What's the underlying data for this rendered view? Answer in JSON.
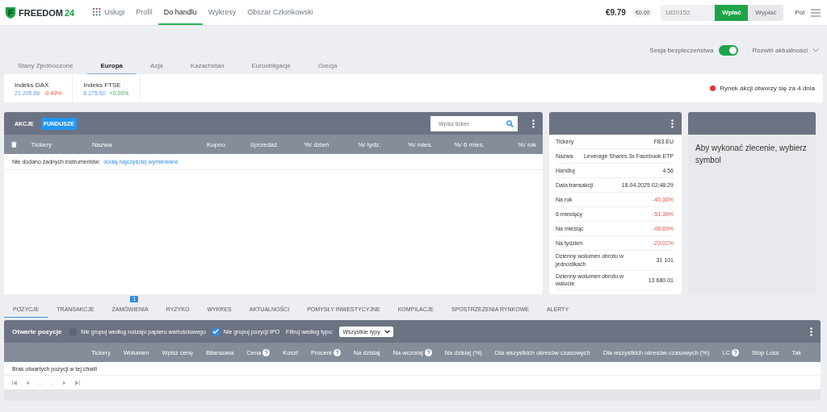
{
  "header": {
    "brand": "FREEDOM",
    "brand_number": "24",
    "nav": [
      {
        "label": "Usługi",
        "kind": "apps",
        "selected": false
      },
      {
        "label": "Profil",
        "kind": "plain",
        "selected": false
      },
      {
        "label": "Do handlu",
        "kind": "plain",
        "selected": true
      },
      {
        "label": "Wykresy",
        "kind": "plain",
        "selected": false
      },
      {
        "label": "Obszar Członkowski",
        "kind": "plain",
        "selected": false
      }
    ],
    "balance": "€9.79",
    "balance_pill": "€0.00",
    "account": "1820152",
    "deposit_button": "Wpłać",
    "withdraw_button": "Wypłać",
    "language": "Pol"
  },
  "security": {
    "label": "Sesja bezpieczeństwa",
    "on": true,
    "news_toggle": "Rozwiń aktualności"
  },
  "regions": [
    {
      "label": "Stany Zjednoczone",
      "selected": false
    },
    {
      "label": "Europa",
      "selected": true
    },
    {
      "label": "Azja",
      "selected": false
    },
    {
      "label": "Kazachstan",
      "selected": false
    },
    {
      "label": "Euroobligacje",
      "selected": false
    },
    {
      "label": "Grecja",
      "selected": false
    }
  ],
  "indices": [
    {
      "name": "Indeks DAX",
      "value": "21 205.86",
      "change": "-0.49%",
      "negative": true
    },
    {
      "name": "Indeks FTSE",
      "value": "8 275.50",
      "change": "+0.00%",
      "negative": false
    }
  ],
  "market_status": {
    "text": "Rynek akcji otworzy się za 4 dnia",
    "color": "#e53935"
  },
  "watchlist": {
    "tabs": [
      {
        "label": "AKCJE",
        "selected": false
      },
      {
        "label": "FUNDUSZE",
        "selected": true
      }
    ],
    "search": {
      "placeholder": "Wpisz ticker"
    },
    "columns": [
      "Tickery",
      "Nazwa",
      "Kupno",
      "Sprzedaż",
      "%/ dzień",
      "%/ tydz.",
      "%/ mies.",
      "%/ 6 mies.",
      "%/ rok"
    ],
    "empty_text": "Nie dodano żadnych instrumentów:",
    "empty_link": "dodaj najczęściej wymieniane"
  },
  "info": {
    "rows": [
      {
        "label": "Tickery",
        "value": "FB3.EU",
        "negative": false
      },
      {
        "label": "Nazwa",
        "value": "Leverage Shares 3x Facebook ETP",
        "negative": false
      },
      {
        "label": "Handluj",
        "value": "4.56",
        "negative": false
      },
      {
        "label": "Data transakcji",
        "value": "18.04.2025 02:48:29",
        "negative": false
      },
      {
        "label": "Na rok",
        "value": "-40.36%",
        "negative": true
      },
      {
        "label": "6 miesięcy",
        "value": "-51.36%",
        "negative": true
      },
      {
        "label": "Na miesiąc",
        "value": "-48.69%",
        "negative": true
      },
      {
        "label": "Na tydzień",
        "value": "-23.01%",
        "negative": true
      },
      {
        "label": "Dzienny wolumen obrotu w jednostkach",
        "value": "31 101",
        "negative": false
      },
      {
        "label": "Dzienny wolumen obrotu w walucie",
        "value": "13 680.01",
        "negative": false
      }
    ]
  },
  "order": {
    "message": "Aby wykonać zlecenie, wybierz symbol"
  },
  "bottom_tabs": [
    {
      "label": "POZYCJE",
      "selected": true
    },
    {
      "label": "TRANSAKCJE",
      "selected": false
    },
    {
      "label": "ZAMÓWIENIA",
      "selected": false,
      "badge": "1"
    },
    {
      "label": "RYZYKO",
      "selected": false
    },
    {
      "label": "WYKRES",
      "selected": false
    },
    {
      "label": "AKTUALNOŚCI",
      "selected": false
    },
    {
      "label": "POMYSŁY INWESTYCYJNE",
      "selected": false
    },
    {
      "label": "KOMPILACJE",
      "selected": false
    },
    {
      "label": "SPOSTRZEŻENIA RYNKOWE",
      "selected": false
    },
    {
      "label": "ALERTY",
      "selected": false
    }
  ],
  "positions": {
    "title": "Otwarte pozycje",
    "options": [
      {
        "label": "Nie grupuj według rodzaju papieru wartościowego",
        "checked": false
      },
      {
        "label": "Nie grupuj pozycji IPO",
        "checked": true
      }
    ],
    "filter_label": "Filtruj według typu:",
    "filter_value": "Wszystkie typy",
    "columns": [
      {
        "label": "Tickery",
        "help": false
      },
      {
        "label": "Wolumen",
        "help": false
      },
      {
        "label": "Wpisz cenę",
        "help": false
      },
      {
        "label": "Bilansowa",
        "help": false
      },
      {
        "label": "Cena",
        "help": true
      },
      {
        "label": "Koszt",
        "help": false
      },
      {
        "label": "Procent",
        "help": true
      },
      {
        "label": "Na dzisiaj",
        "help": false
      },
      {
        "label": "Na wczoraj",
        "help": true
      },
      {
        "label": "Na dzisiaj (%)",
        "help": false
      },
      {
        "label": "Dla wszystkich okresów czasowych",
        "help": false
      },
      {
        "label": "Dla wszystkich okresów czasowych (%)",
        "help": false
      },
      {
        "label": "LC",
        "help": true
      },
      {
        "label": "Stop Loss",
        "help": false
      },
      {
        "label": "Tak",
        "help": false
      }
    ],
    "empty_text": "Brak otwartych pozycji w tej chwili",
    "pagination": [
      "...",
      "..."
    ]
  }
}
